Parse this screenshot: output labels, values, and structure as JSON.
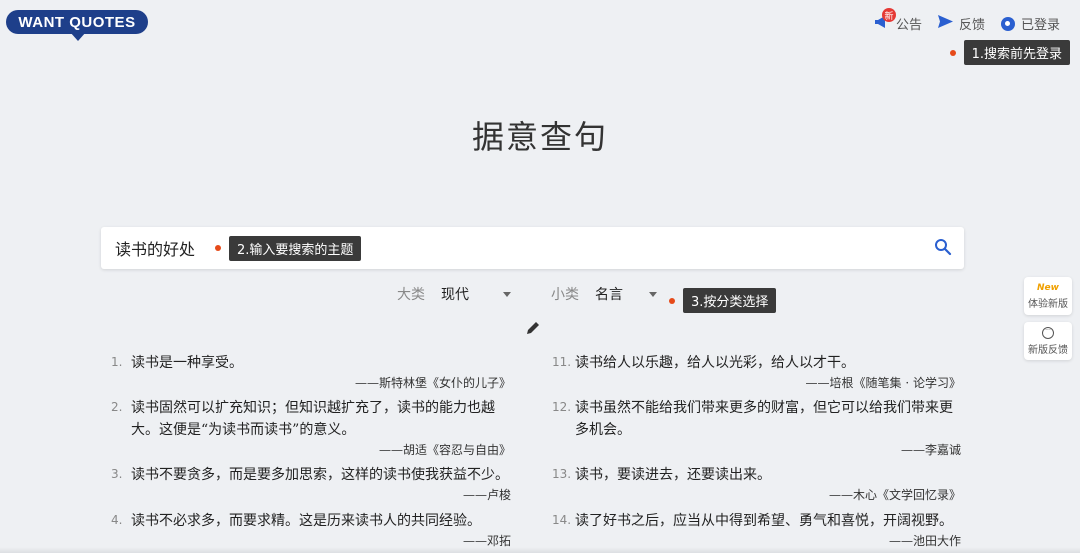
{
  "logo": {
    "text": "WANT QUOTES"
  },
  "nav": {
    "announce": {
      "label": "公告",
      "badge": "新"
    },
    "feedback": {
      "label": "反馈"
    },
    "login": {
      "label": "已登录"
    }
  },
  "tips": {
    "login": "1.搜索前先登录",
    "search": "2.输入要搜索的主题",
    "category": "3.按分类选择"
  },
  "page_title": "据意查句",
  "search": {
    "value": "读书的好处"
  },
  "filters": {
    "major": {
      "label": "大类",
      "value": "现代"
    },
    "minor": {
      "label": "小类",
      "value": "名言"
    }
  },
  "quotes_left": [
    {
      "num": "1.",
      "text": "读书是一种享受。",
      "author": "——斯特林堡《女仆的儿子》"
    },
    {
      "num": "2.",
      "text": "读书固然可以扩充知识；但知识越扩充了，读书的能力也越大。这便是“为读书而读书”的意义。",
      "author": "——胡适《容忍与自由》"
    },
    {
      "num": "3.",
      "text": "读书不要贪多，而是要多加思索，这样的读书使我获益不少。",
      "author": "——卢梭"
    },
    {
      "num": "4.",
      "text": "读书不必求多，而要求精。这是历来读书人的共同经验。",
      "author": "——邓拓"
    }
  ],
  "quotes_right": [
    {
      "num": "11.",
      "text": "读书给人以乐趣，给人以光彩，给人以才干。",
      "author": "——培根《随笔集 · 论学习》"
    },
    {
      "num": "12.",
      "text": "读书虽然不能给我们带来更多的财富，但它可以给我们带来更多机会。",
      "author": "——李嘉诚"
    },
    {
      "num": "13.",
      "text": "读书，要读进去，还要读出来。",
      "author": "——木心《文学回忆录》"
    },
    {
      "num": "14.",
      "text": "读了好书之后，应当从中得到希望、勇气和喜悦，开阔视野。",
      "author": "——池田大作"
    }
  ],
  "side": {
    "new_version": {
      "mark": "New",
      "label": "体验新版"
    },
    "feedback": {
      "label": "新版反馈"
    }
  }
}
